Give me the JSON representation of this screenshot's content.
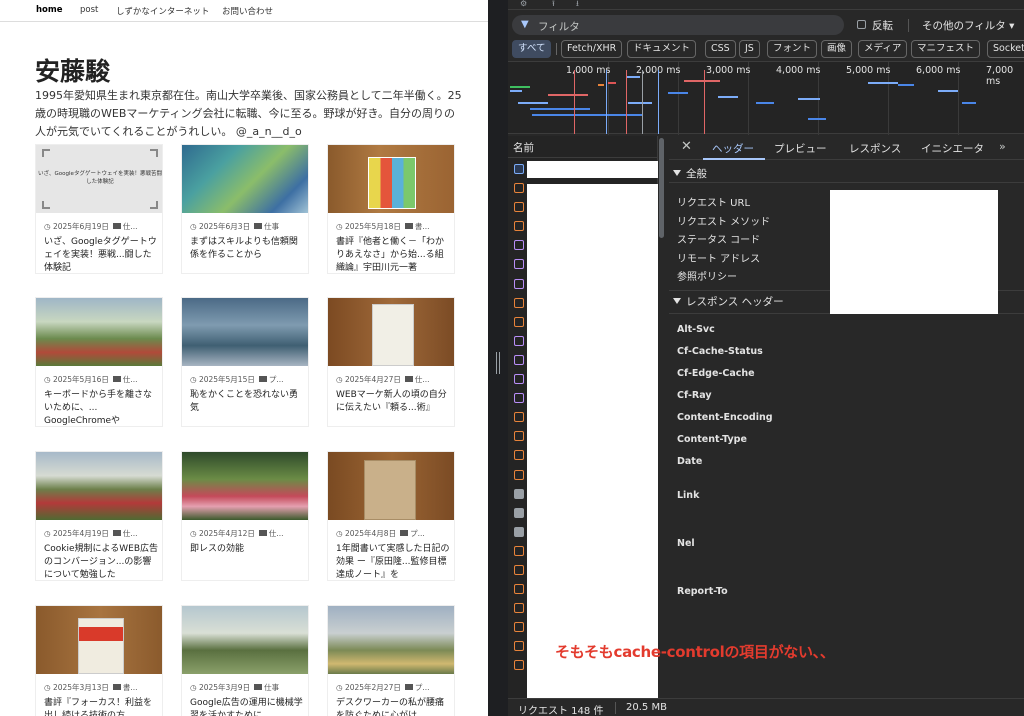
{
  "blog": {
    "nav": [
      "home",
      "post",
      "しずかなインターネット",
      "お問い合わせ"
    ],
    "author": "安藤駿",
    "bio": "1995年愛知県生まれ東京都在住。南山大学卒業後、国家公務員として二年半働く。25歳の時現職のWEBマーケティング会社に転職、今に至る。野球が好き。自分の周りの人が元気でいてくれることがうれしい。 @_a_n__d_o",
    "thumb0_text": "いざ、Googleタグゲートウェイを実装！悪戦苦闘した体験記",
    "posts": [
      {
        "date": "2025年6月19日",
        "cat": "仕...",
        "title": "いざ、Googleタグゲートウェイを実装！悪戦...闘した体験記"
      },
      {
        "date": "2025年6月3日",
        "cat": "仕事",
        "title": "まずはスキルよりも信頼関係を作ることから"
      },
      {
        "date": "2025年5月18日",
        "cat": "書...",
        "title": "書評『他者と働く－「わかりあえなさ」から始...る組織論』宇田川元一著"
      },
      {
        "date": "2025年5月16日",
        "cat": "仕...",
        "title": "キーボードから手を離さないために、... GoogleChromeや"
      },
      {
        "date": "2025年5月15日",
        "cat": "プ...",
        "title": "恥をかくことを恐れない勇気"
      },
      {
        "date": "2025年4月27日",
        "cat": "仕...",
        "title": "WEBマーケ新人の頃の自分に伝えたい『頼る...術』"
      },
      {
        "date": "2025年4月19日",
        "cat": "仕...",
        "title": "Cookie規制によるWEB広告のコンバージョン...の影響について勉強した"
      },
      {
        "date": "2025年4月12日",
        "cat": "仕...",
        "title": "即レスの効能"
      },
      {
        "date": "2025年4月8日",
        "cat": "プ...",
        "title": "1年間書いて実感した日記の効果 ー『原田隆...監修目標達成ノート』を"
      },
      {
        "date": "2025年3月13日",
        "cat": "書...",
        "title": "書評『フォーカス！利益を出し続ける技術の方..."
      },
      {
        "date": "2025年3月9日",
        "cat": "仕事",
        "title": "Google広告の運用に機械学習を活かすために..."
      },
      {
        "date": "2025年2月27日",
        "cat": "プ...",
        "title": "デスクワーカーの私が腰痛を防ぐために心がけ..."
      }
    ]
  },
  "devtools": {
    "filter_placeholder": "フィルタ",
    "invert_label": "反転",
    "more_filters": "その他のフィルタ ▾",
    "types": [
      "すべて",
      "Fetch/XHR",
      "ドキュメント",
      "CSS",
      "JS",
      "フォント",
      "画像",
      "メディア",
      "マニフェスト",
      "Socket"
    ],
    "ticks": [
      "1,000 ms",
      "2,000 ms",
      "3,000 ms",
      "4,000 ms",
      "5,000 ms",
      "6,000 ms",
      "7,000 ms"
    ],
    "name_header": "名前",
    "tabs": [
      "ヘッダー",
      "プレビュー",
      "レスポンス",
      "イニシエータ"
    ],
    "general_title": "全般",
    "general_keys": [
      "リクエスト URL",
      "リクエスト メソッド",
      "ステータス コード",
      "リモート アドレス",
      "参照ポリシー"
    ],
    "response_title": "レスポンス ヘッダー",
    "response_keys": [
      "Alt-Svc",
      "Cf-Cache-Status",
      "Cf-Edge-Cache",
      "Cf-Ray",
      "Content-Encoding",
      "Content-Type",
      "Date",
      "Link",
      "Nel",
      "Report-To"
    ],
    "status_requests": "リクエスト 148 件",
    "status_transfer": "20.5 MB"
  },
  "annotation": "そもそもcache-controlの項目がない、、",
  "colors": {
    "annotation": "#e33b2e",
    "devtools_bg": "#282828",
    "active_tab": "#a8c7fa",
    "chip_active": "#3f4b60"
  }
}
